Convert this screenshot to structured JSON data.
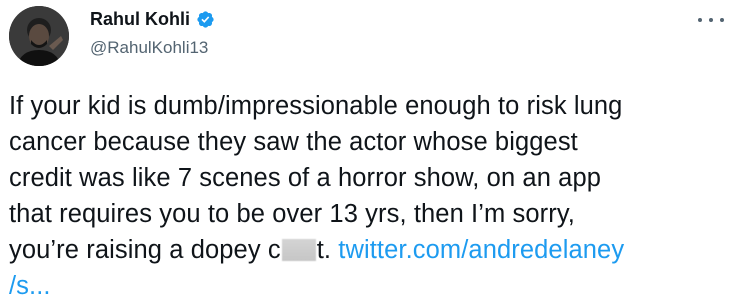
{
  "author": {
    "name": "Rahul Kohli",
    "handle": "@RahulKohli13",
    "verified": true
  },
  "tweet": {
    "line1": "If your kid is dumb/impressionable enough to risk lung",
    "line2": "cancer because they saw the actor whose biggest",
    "line3": "credit was like 7 scenes of a horror show, on an app",
    "line4": "that requires you to be over 13 yrs, then I’m sorry,",
    "line5_before": "you’re raising a dopey c",
    "line5_after": "t. ",
    "link_part1": "twitter.com/andredelaney",
    "link_part2": "/s..."
  },
  "icons": {
    "verified": "verified-badge-icon",
    "more": "more-options-icon"
  },
  "colors": {
    "text": "#0f1419",
    "secondary": "#536471",
    "link": "#1d9bf0",
    "verified": "#1d9bf0"
  }
}
